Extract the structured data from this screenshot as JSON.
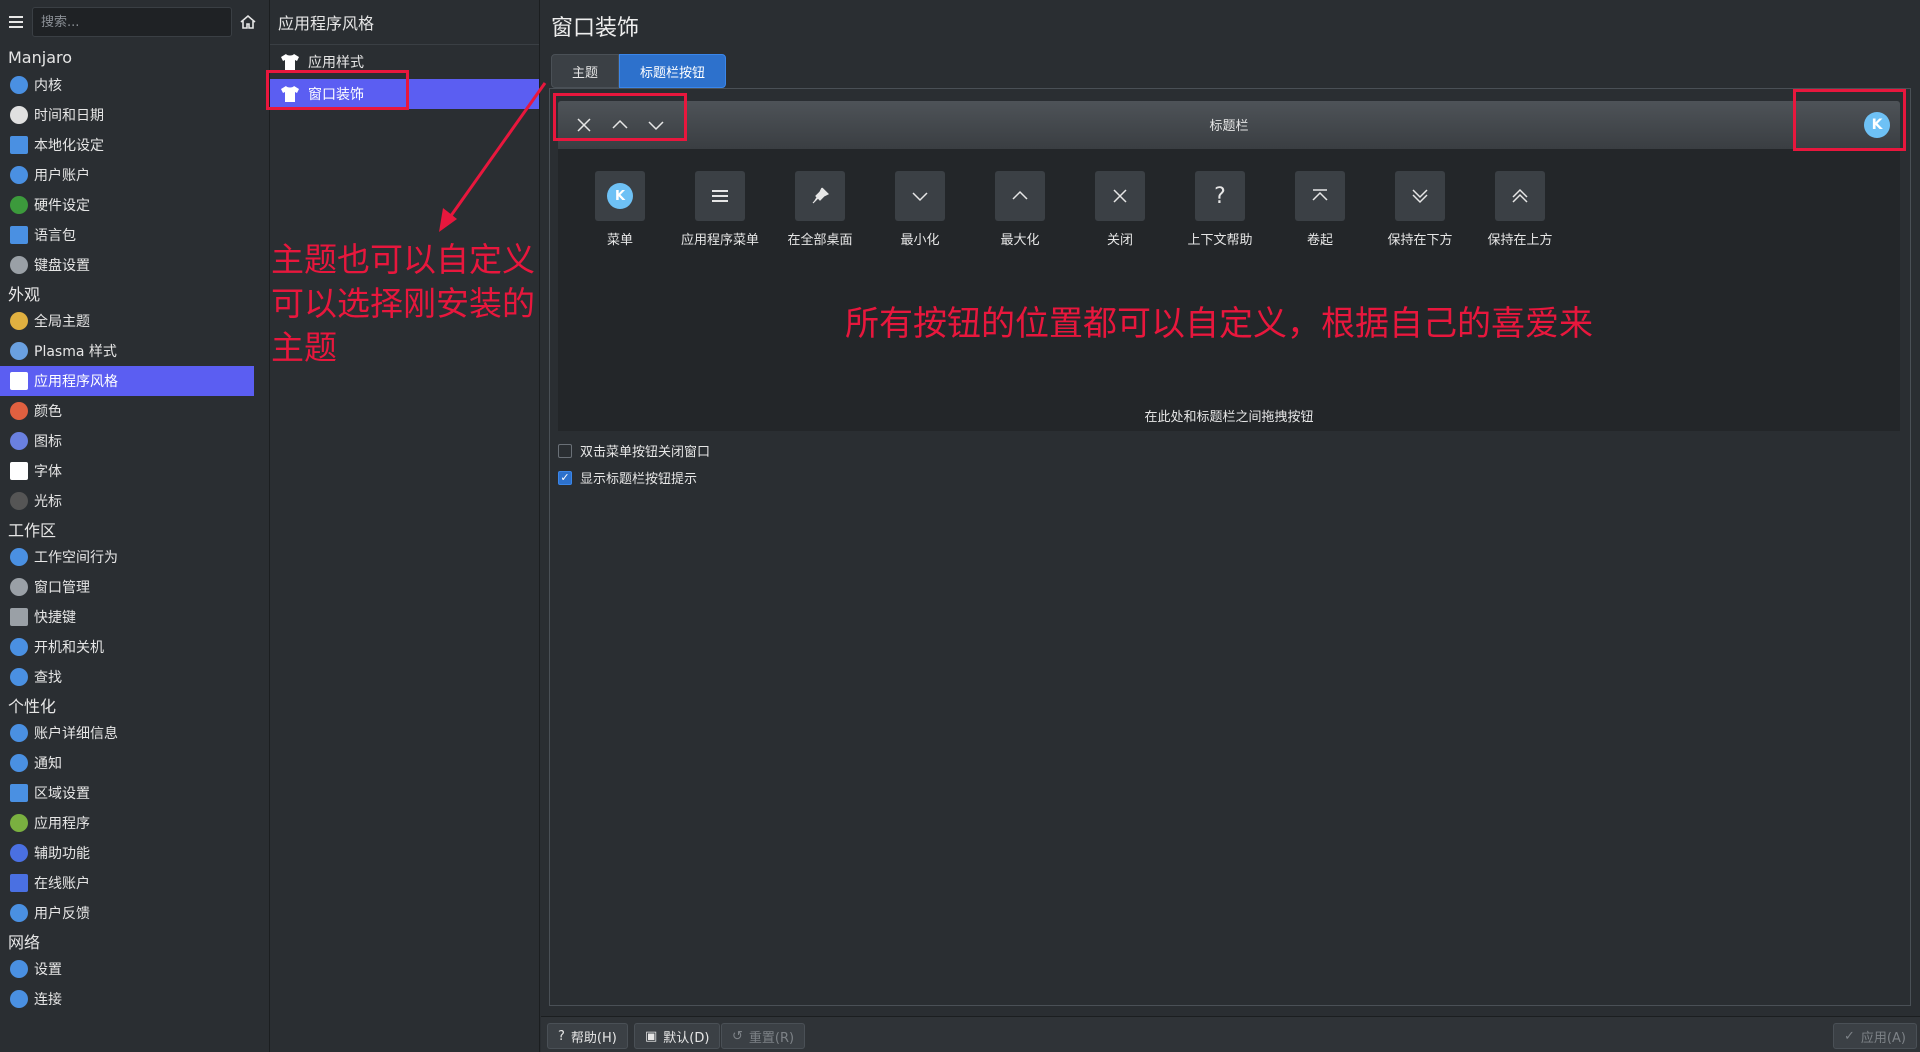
{
  "sidebar": {
    "search_placeholder": "搜索...",
    "sections": [
      {
        "title": "Manjaro",
        "items": [
          {
            "label": "内核",
            "icon": "kernel-icon",
            "color": "#4a90e2"
          },
          {
            "label": "时间和日期",
            "icon": "clock-icon",
            "color": "#e0e0e0"
          },
          {
            "label": "本地化设定",
            "icon": "locale-icon",
            "color": "#4a90e2"
          },
          {
            "label": "用户账户",
            "icon": "user-icon",
            "color": "#4a90e2"
          },
          {
            "label": "硬件设定",
            "icon": "hardware-icon",
            "color": "#3c9a3c"
          },
          {
            "label": "语言包",
            "icon": "language-icon",
            "color": "#4a90e2"
          },
          {
            "label": "键盘设置",
            "icon": "keyboard-icon",
            "color": "#9aa0a6"
          }
        ]
      },
      {
        "title": "外观",
        "items": [
          {
            "label": "全局主题",
            "icon": "global-theme-icon",
            "color": "#e0b040"
          },
          {
            "label": "Plasma 样式",
            "icon": "plasma-style-icon",
            "color": "#6aa0e0"
          },
          {
            "label": "应用程序风格",
            "icon": "shirt-icon",
            "color": "#ffffff",
            "active": true
          },
          {
            "label": "颜色",
            "icon": "colors-icon",
            "color": "#e06040"
          },
          {
            "label": "图标",
            "icon": "icons-icon",
            "color": "#6a80e0"
          },
          {
            "label": "字体",
            "icon": "fonts-icon",
            "color": "#ffffff"
          },
          {
            "label": "光标",
            "icon": "cursor-icon",
            "color": "#555555"
          }
        ]
      },
      {
        "title": "工作区",
        "items": [
          {
            "label": "工作空间行为",
            "icon": "workspace-icon",
            "color": "#4a90e2"
          },
          {
            "label": "窗口管理",
            "icon": "window-mgmt-icon",
            "color": "#9aa0a6"
          },
          {
            "label": "快捷键",
            "icon": "shortcuts-icon",
            "color": "#9aa0a6"
          },
          {
            "label": "开机和关机",
            "icon": "startup-icon",
            "color": "#4a90e2"
          },
          {
            "label": "查找",
            "icon": "search-settings-icon",
            "color": "#4a90e2"
          }
        ]
      },
      {
        "title": "个性化",
        "items": [
          {
            "label": "账户详细信息",
            "icon": "account-icon",
            "color": "#4a90e2"
          },
          {
            "label": "通知",
            "icon": "notification-icon",
            "color": "#4a90e2"
          },
          {
            "label": "区域设置",
            "icon": "region-icon",
            "color": "#4a90e2"
          },
          {
            "label": "应用程序",
            "icon": "applications-icon",
            "color": "#7ab040"
          },
          {
            "label": "辅助功能",
            "icon": "accessibility-icon",
            "color": "#4a70e2"
          },
          {
            "label": "在线账户",
            "icon": "online-accounts-icon",
            "color": "#4a70e2"
          },
          {
            "label": "用户反馈",
            "icon": "feedback-icon",
            "color": "#4a90e2"
          }
        ]
      },
      {
        "title": "网络",
        "items": [
          {
            "label": "设置",
            "icon": "network-settings-icon",
            "color": "#4a90e2"
          },
          {
            "label": "连接",
            "icon": "connections-icon",
            "color": "#4a90e2"
          }
        ]
      }
    ]
  },
  "subnav": {
    "title": "应用程序风格",
    "items": [
      {
        "label": "应用样式"
      },
      {
        "label": "窗口装饰",
        "active": true
      }
    ]
  },
  "main": {
    "title": "窗口装饰",
    "tabs": [
      {
        "label": "主题"
      },
      {
        "label": "标题栏按钮",
        "active": true
      }
    ],
    "titlebar_label": "标题栏",
    "tray_buttons": [
      {
        "label": "菜单",
        "icon": "kde-menu-icon"
      },
      {
        "label": "应用程序菜单",
        "icon": "app-menu-icon"
      },
      {
        "label": "在全部桌面",
        "icon": "pin-icon"
      },
      {
        "label": "最小化",
        "icon": "minimize-icon"
      },
      {
        "label": "最大化",
        "icon": "maximize-icon"
      },
      {
        "label": "关闭",
        "icon": "close-icon"
      },
      {
        "label": "上下文帮助",
        "icon": "help-icon"
      },
      {
        "label": "卷起",
        "icon": "shade-icon"
      },
      {
        "label": "保持在下方",
        "icon": "keep-below-icon"
      },
      {
        "label": "保持在上方",
        "icon": "keep-above-icon"
      }
    ],
    "tray_hint": "在此处和标题栏之间拖拽按钮",
    "checkbox_close_dblclick": {
      "label": "双击菜单按钮关闭窗口",
      "checked": false
    },
    "checkbox_tooltips": {
      "label": "显示标题栏按钮提示",
      "checked": true
    }
  },
  "footer": {
    "help": "帮助(H)",
    "defaults": "默认(D)",
    "reset": "重置(R)",
    "apply": "应用(A)"
  },
  "annotations": {
    "left_line1": "主题也可以自定义",
    "left_line2": "可以选择刚安装的",
    "left_line3": "主题",
    "center": "所有按钮的位置都可以自定义，根据自己的喜爱来",
    "color": "#e8173d"
  }
}
